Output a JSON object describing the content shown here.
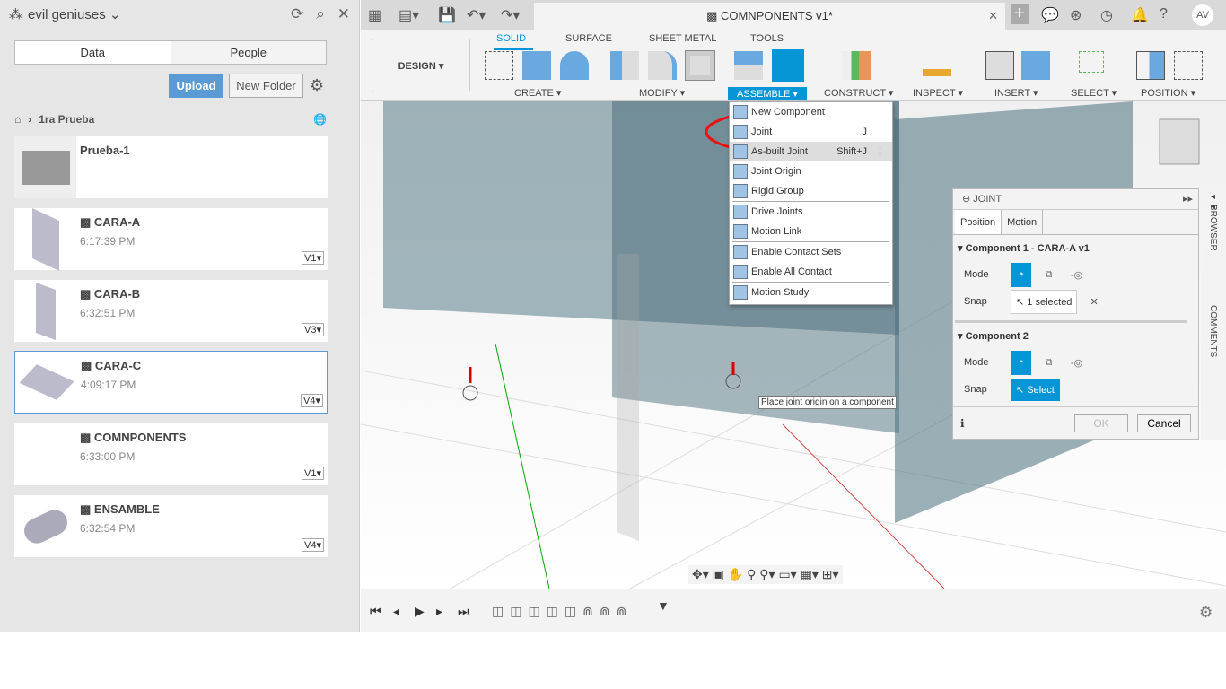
{
  "left": {
    "team": "evil geniuses",
    "tabs": [
      "Data",
      "People"
    ],
    "upload": "Upload",
    "new_folder": "New Folder",
    "breadcrumb": "1ra Prueba",
    "folder": {
      "name": "Prueba-1"
    },
    "files": [
      {
        "name": "CARA-A",
        "time": "6:17:39 PM",
        "ver": "V1"
      },
      {
        "name": "CARA-B",
        "time": "6:32:51 PM",
        "ver": "V3"
      },
      {
        "name": "CARA-C",
        "time": "4:09:17 PM",
        "ver": "V4"
      },
      {
        "name": "COMNPONENTS",
        "time": "6:33:00 PM",
        "ver": "V1"
      },
      {
        "name": "ENSAMBLE",
        "time": "6:32:54 PM",
        "ver": "V4"
      }
    ]
  },
  "doc_tab": "COMNPONENTS v1*",
  "user": "AV",
  "ribbon": {
    "design": "DESIGN ▾",
    "tabs": [
      "SOLID",
      "SURFACE",
      "SHEET METAL",
      "TOOLS"
    ],
    "groups": [
      "CREATE ▾",
      "MODIFY ▾",
      "ASSEMBLE ▾",
      "CONSTRUCT ▾",
      "INSPECT ▾",
      "INSERT ▾",
      "SELECT ▾",
      "POSITION ▾"
    ]
  },
  "menu": [
    {
      "label": "New Component"
    },
    {
      "label": "Joint",
      "shortcut": "J"
    },
    {
      "label": "As-built Joint",
      "shortcut": "Shift+J"
    },
    {
      "label": "Joint Origin"
    },
    {
      "label": "Rigid Group"
    },
    {
      "label": "Drive Joints"
    },
    {
      "label": "Motion Link"
    },
    {
      "label": "Enable Contact Sets"
    },
    {
      "label": "Enable All Contact"
    },
    {
      "label": "Motion Study"
    }
  ],
  "joint": {
    "title": "JOINT",
    "tabs": [
      "Position",
      "Motion"
    ],
    "c1": "Component 1 - CARA-A v1",
    "c2": "Component 2",
    "mode": "Mode",
    "snap": "Snap",
    "selected": "1 selected",
    "select": "Select",
    "ok": "OK",
    "cancel": "Cancel"
  },
  "side": {
    "browser": "BROWSER",
    "comments": "COMMENTS"
  },
  "tooltip": "Place joint origin on a component",
  "accent": "#0696d7"
}
